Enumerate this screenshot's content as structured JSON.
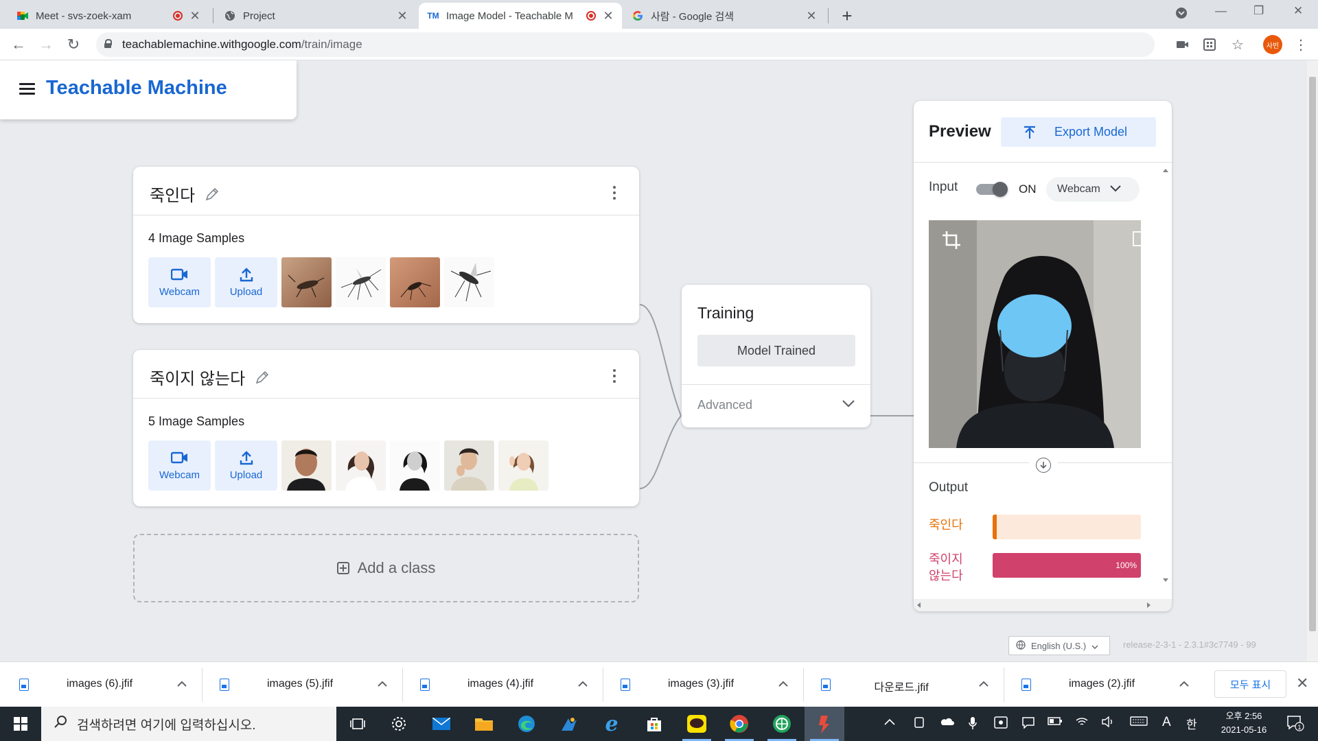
{
  "browser": {
    "tabs": [
      {
        "title": "Meet - svs-zoek-xam",
        "icon": "google-meet-icon"
      },
      {
        "title": "Project",
        "icon": "globe-icon"
      },
      {
        "title": "Image Model - Teachable M",
        "icon": "teachable-machine-icon"
      },
      {
        "title": "사람 - Google 검색",
        "icon": "google-icon"
      }
    ],
    "url_host": "teachablemachine.withgoogle.com",
    "url_path": "/train/image",
    "profile_initials": "사빈"
  },
  "app": {
    "brand": "Teachable Machine"
  },
  "classes": [
    {
      "name": "죽인다",
      "count_label": "4 Image Samples",
      "webcam_label": "Webcam",
      "upload_label": "Upload",
      "thumb_count": 4
    },
    {
      "name": "죽이지 않는다",
      "count_label": "5 Image Samples",
      "webcam_label": "Webcam",
      "upload_label": "Upload",
      "thumb_count": 5
    }
  ],
  "add_class_label": "Add a class",
  "training": {
    "title": "Training",
    "button_label": "Model Trained",
    "advanced_label": "Advanced"
  },
  "preview": {
    "title": "Preview",
    "export_label": "Export Model",
    "input_label": "Input",
    "toggle_state": "ON",
    "source_label": "Webcam",
    "output_label": "Output",
    "outputs": [
      {
        "label": "죽인다",
        "percent": 0,
        "percent_label": "",
        "color": "#e8710a",
        "track": "#fde9dc"
      },
      {
        "label": "죽이지 않는다",
        "percent": 100,
        "percent_label": "100%",
        "color": "#d0416b",
        "track": "#fbe0e8"
      }
    ]
  },
  "footer": {
    "language": "English (U.S.)",
    "release": "release-2-3-1 - 2.3.1#3c7749 - 99"
  },
  "downloads": {
    "items": [
      "images (6).jfif",
      "images (5).jfif",
      "images (4).jfif",
      "images (3).jfif",
      "다운로드.jfif",
      "images (2).jfif"
    ],
    "show_all_label": "모두 표시"
  },
  "taskbar": {
    "search_placeholder": "검색하려면 여기에 입력하십시오.",
    "ime_mode": "A",
    "ime_lang": "한",
    "time": "오후 2:56",
    "date": "2021-05-16",
    "notif_count": "1"
  }
}
